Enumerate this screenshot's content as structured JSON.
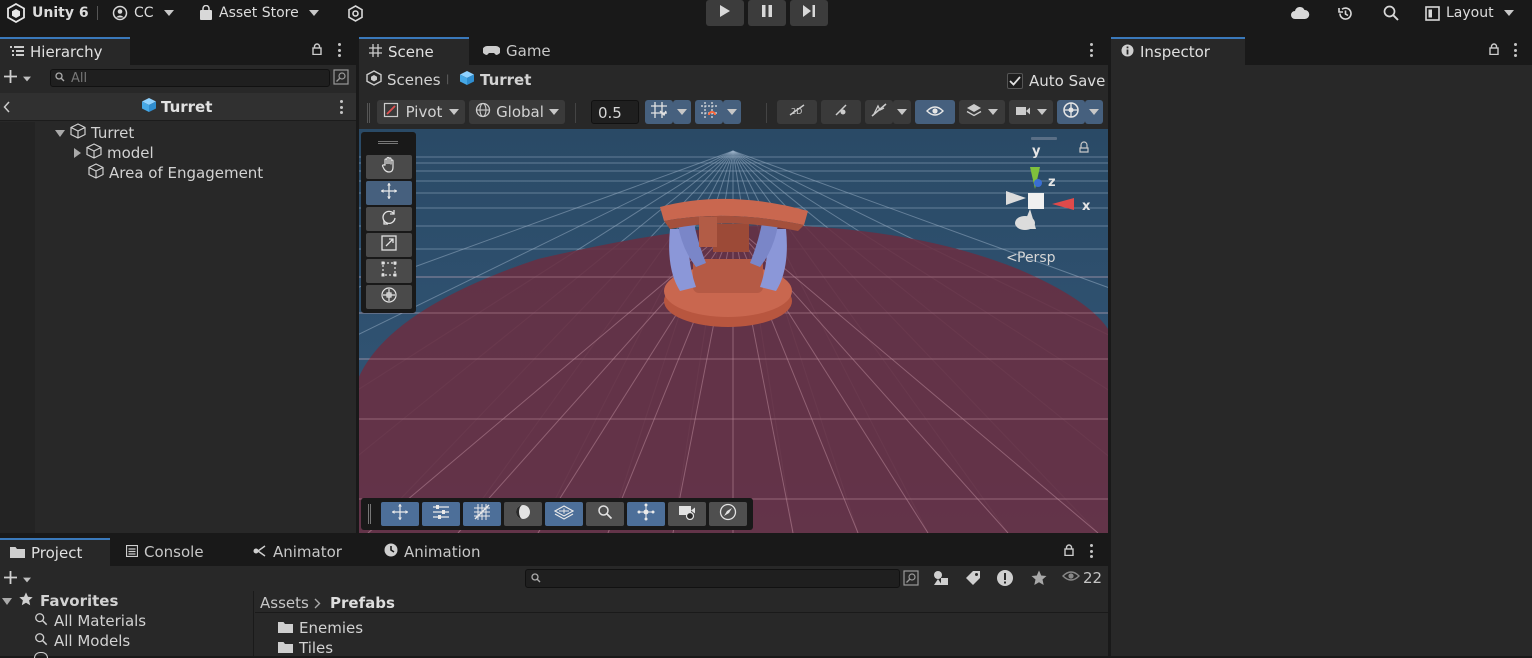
{
  "topbar": {
    "app_title": "Unity 6",
    "account": "CC",
    "asset_store": "Asset Store",
    "layout": "Layout"
  },
  "hierarchy": {
    "tab": "Hierarchy",
    "search_placeholder": "All",
    "scene_title": "Turret",
    "items": [
      {
        "label": "Turret"
      },
      {
        "label": "model"
      },
      {
        "label": "Area of Engagement"
      }
    ]
  },
  "scene": {
    "tabs": [
      "Scene",
      "Game"
    ],
    "breadcrumb_root": "Scenes",
    "breadcrumb_current": "Turret",
    "auto_save_label": "Auto Save",
    "auto_save_checked": true,
    "pivot_label": "Pivot",
    "space_label": "Global",
    "snap_value": "0.5",
    "projection_label": "Persp",
    "gizmo_axes": [
      "y",
      "z",
      "x"
    ],
    "colors": {
      "ground": "#6a2f42",
      "sky": "#305470",
      "turret": "#c9674f",
      "turret_blue": "#8b97d8"
    }
  },
  "inspector": {
    "tab": "Inspector"
  },
  "project": {
    "tabs": [
      "Project",
      "Console",
      "Animator",
      "Animation"
    ],
    "visible_count": "22",
    "favorites_label": "Favorites",
    "favorites": [
      "All Materials",
      "All Models"
    ],
    "breadcrumb_root": "Assets",
    "breadcrumb_current": "Prefabs",
    "folders": [
      "Enemies",
      "Tiles"
    ]
  }
}
